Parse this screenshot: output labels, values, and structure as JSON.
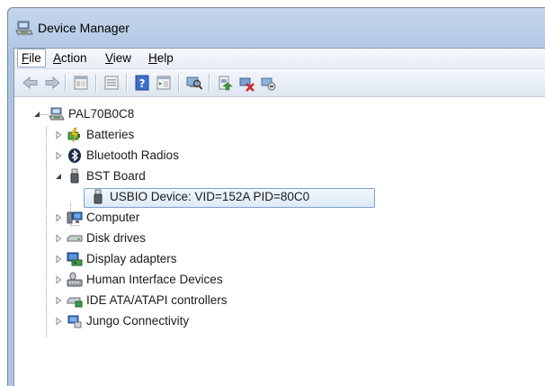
{
  "window": {
    "title": "Device Manager"
  },
  "menu": [
    {
      "underline": "F",
      "rest": "ile"
    },
    {
      "underline": "A",
      "rest": "ction"
    },
    {
      "underline": "V",
      "rest": "iew"
    },
    {
      "underline": "H",
      "rest": "elp"
    }
  ],
  "toolbar": {
    "buttons": [
      "back-arrow-icon",
      "forward-arrow-icon",
      "properties-icon",
      "show-hidden-icon",
      "help-icon",
      "action-pane-icon",
      "scan-hardware-icon",
      "update-driver-icon",
      "disable-device-icon",
      "uninstall-device-icon"
    ]
  },
  "tree": {
    "root": "PAL70B0C8",
    "items": [
      {
        "label": "Batteries",
        "icon": "battery-icon"
      },
      {
        "label": "Bluetooth Radios",
        "icon": "bluetooth-icon"
      },
      {
        "label": "BST Board",
        "icon": "usb-plug-icon",
        "expanded": true
      },
      {
        "label": "USBIO Device: VID=152A PID=80C0",
        "icon": "usb-plug-icon",
        "selected": true
      },
      {
        "label": "Computer",
        "icon": "computer-icon"
      },
      {
        "label": "Disk drives",
        "icon": "disk-drive-icon"
      },
      {
        "label": "Display adapters",
        "icon": "display-adapter-icon"
      },
      {
        "label": "Human Interface Devices",
        "icon": "hid-icon"
      },
      {
        "label": "IDE ATA/ATAPI controllers",
        "icon": "ide-controller-icon"
      },
      {
        "label": "Jungo Connectivity",
        "icon": "jungo-icon"
      }
    ]
  }
}
